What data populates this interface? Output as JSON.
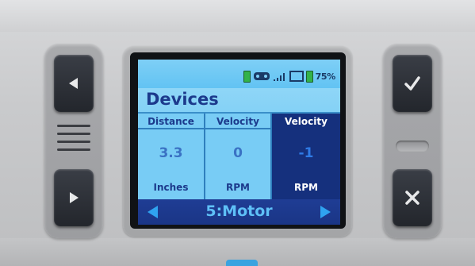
{
  "status": {
    "battery_percent": "75%"
  },
  "screen": {
    "title": "Devices",
    "panels": [
      {
        "header": "Distance",
        "value": "3.3",
        "unit": "Inches"
      },
      {
        "header": "Velocity",
        "value": "0",
        "unit": "RPM"
      },
      {
        "header": "Velocity",
        "value": "-1",
        "unit": "RPM"
      }
    ],
    "nav": {
      "label": "5:Motor"
    }
  },
  "colors": {
    "screen_bg": "#2d9de6",
    "highlight_panel": "#15307d",
    "title_text": "#1c3a8c",
    "nav_bar": "#1f3d94"
  },
  "icons": {
    "left_button": "triangle-left-icon",
    "right_button": "triangle-right-icon",
    "confirm_button": "check-icon",
    "cancel_button": "x-icon"
  }
}
